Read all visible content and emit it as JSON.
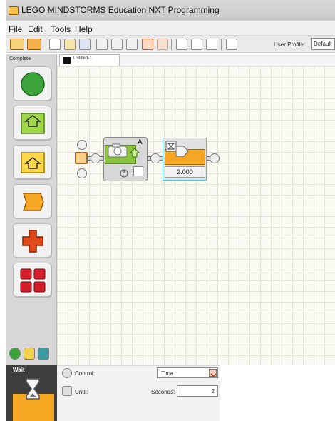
{
  "window": {
    "title": "LEGO MINDSTORMS Education NXT Programming",
    "icon": "nxt-app-icon"
  },
  "menu": {
    "items": [
      "File",
      "Edit",
      "Tools",
      "Help"
    ]
  },
  "toolbar": {
    "buttons": [
      "mini-program-icon",
      "new-file-icon",
      "open-folder-icon",
      "save-icon",
      "cut-icon",
      "copy-icon",
      "paste-icon",
      "undo-icon",
      "redo-icon",
      "pointer-tool-icon",
      "pan-tool-icon",
      "comment-tool-icon",
      "custom-palette-icon"
    ],
    "user_profile_label": "User Profile:",
    "user_profile_value": "Default"
  },
  "palette": {
    "title": "Complete",
    "blocks": [
      "common-block-icon",
      "action-block-icon",
      "sensor-block-icon",
      "flow-block-icon",
      "data-block-icon",
      "advanced-block-icon"
    ],
    "tabs": [
      "common-palette-tab",
      "complete-palette-tab",
      "custom-palette-tab"
    ]
  },
  "document": {
    "tab_label": "Untitled-1"
  },
  "program": {
    "motor_block": {
      "port_label": "A",
      "icon": "motor-move-icon"
    },
    "wait_block": {
      "value": "2.000",
      "icon": "wait-timer-icon"
    }
  },
  "config": {
    "block_name": "Wait",
    "block_icon": "hourglass-icon",
    "control_label": "Control:",
    "control_value": "Time",
    "until_label": "Until:",
    "seconds_label": "Seconds:",
    "seconds_value": "2"
  },
  "colors": {
    "accent_orange": "#f5a623",
    "motor_green": "#8bc43f",
    "selection_teal": "#4fc3c9",
    "palette_green": "#3aa43b",
    "palette_red": "#e04a1c"
  }
}
